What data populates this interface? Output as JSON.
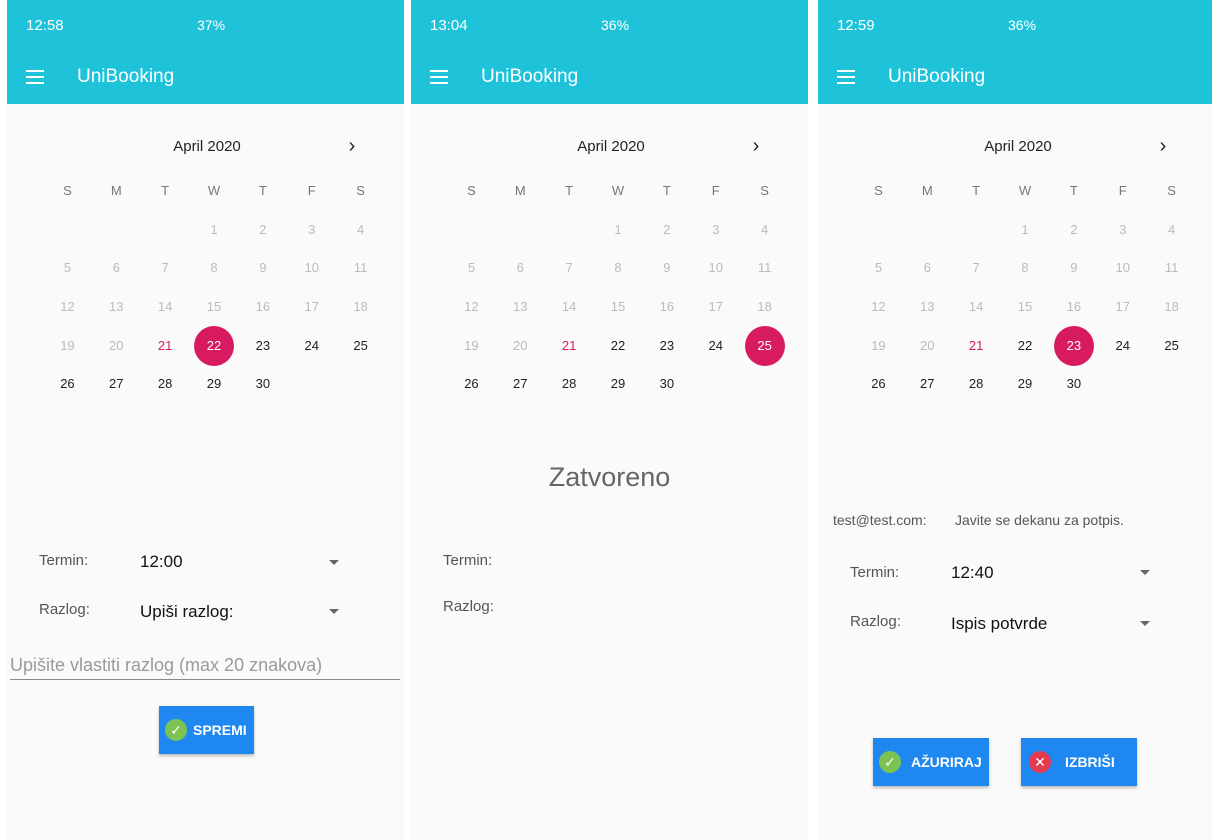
{
  "screens": [
    {
      "status_time": "12:58",
      "status_right": "37%",
      "app_title": "UniBooking",
      "month": "April 2020",
      "selected_day": "22",
      "termin_label": "Termin:",
      "termin_value": "12:00",
      "razlog_label": "Razlog:",
      "razlog_value": "Upiši razlog:",
      "custom_reason_placeholder": "Upišite vlastiti razlog (max 20 znakova)",
      "save_label": "SPREMI"
    },
    {
      "status_time": "13:04",
      "status_right": "36%",
      "app_title": "UniBooking",
      "month": "April 2020",
      "selected_day": "25",
      "closed_text": "Zatvoreno",
      "termin_label": "Termin:",
      "razlog_label": "Razlog:"
    },
    {
      "status_time": "12:59",
      "status_right": "36%",
      "app_title": "UniBooking",
      "month": "April 2020",
      "selected_day": "23",
      "email": "test@test.com:",
      "note": "Javite se dekanu za potpis.",
      "termin_label": "Termin:",
      "termin_value": "12:40",
      "razlog_label": "Razlog:",
      "razlog_value": "Ispis potvrde",
      "update_label": "AŽURIRAJ",
      "delete_label": "IZBRIŠI"
    }
  ],
  "calendar": {
    "weekdays": [
      "S",
      "M",
      "T",
      "W",
      "T",
      "F",
      "S"
    ],
    "weeks": [
      [
        "",
        "",
        "",
        "1",
        "2",
        "3",
        "4"
      ],
      [
        "5",
        "6",
        "7",
        "8",
        "9",
        "10",
        "11"
      ],
      [
        "12",
        "13",
        "14",
        "15",
        "16",
        "17",
        "18"
      ],
      [
        "19",
        "20",
        "21",
        "22",
        "23",
        "24",
        "25"
      ],
      [
        "26",
        "27",
        "28",
        "29",
        "30",
        "",
        ""
      ]
    ],
    "disabled_days": [
      "1",
      "2",
      "3",
      "4",
      "5",
      "6",
      "7",
      "8",
      "9",
      "10",
      "11",
      "12",
      "13",
      "14",
      "15",
      "16",
      "17",
      "18",
      "19",
      "20"
    ],
    "today": "21"
  },
  "colors": {
    "appbar": "#1ec3d9",
    "selected": "#d81b60",
    "button": "#1e88f0",
    "ok_icon": "#7cc353",
    "delete_icon": "#e53950"
  },
  "icons": {
    "menu": "hamburger-icon",
    "next": "chevron-right-icon",
    "dropdown": "arrow-drop-down-icon",
    "ok": "check-circle-icon",
    "delete": "close-circle-icon"
  }
}
